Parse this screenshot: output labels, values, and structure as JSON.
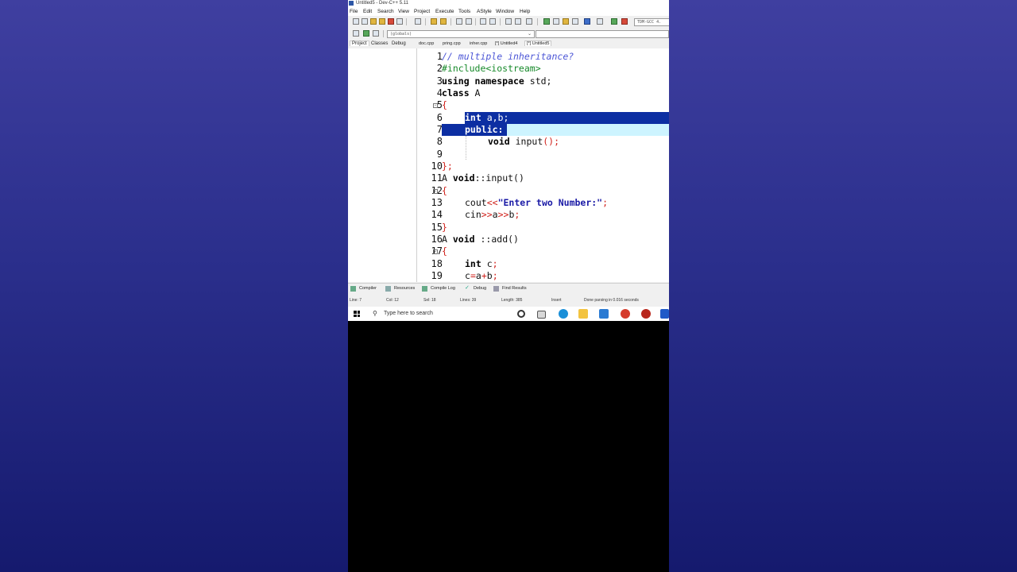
{
  "window": {
    "title": "Untitled5 - Dev-C++ 5.11"
  },
  "menu": [
    "File",
    "Edit",
    "Search",
    "View",
    "Project",
    "Execute",
    "Tools",
    "AStyle",
    "Window",
    "Help"
  ],
  "toolbar": {
    "compiler_select": "TDM-GCC 4.",
    "scope_select": "(globals)"
  },
  "left_panel": {
    "tabs": [
      "Project",
      "Classes",
      "Debug"
    ]
  },
  "file_tabs": [
    "doc.cpp",
    "pring.cpp",
    "inher.cpp",
    "[*] Untitled4",
    "[*] Untitled5"
  ],
  "editor": {
    "line_numbers": [
      "1",
      "2",
      "3",
      "4",
      "5",
      "6",
      "7",
      "8",
      "9",
      "10",
      "11",
      "12",
      "13",
      "14",
      "15",
      "16",
      "17",
      "18",
      "19"
    ],
    "lines": {
      "l1": "// multiple inheritance?",
      "l2": "#include<iostream>",
      "l3a": "using namespace",
      "l3b": " std;",
      "l4a": "class",
      "l4b": " A",
      "l5": "{",
      "l6a": "int",
      "l6b": " a,b;",
      "l7": "public:",
      "l8a": "void",
      "l8b": " input",
      "l8c": "();",
      "l10": "};",
      "l11a": "A ",
      "l11b": "void",
      "l11c": "::",
      "l11d": "input",
      "l11e": "()",
      "l12": "{",
      "l13a": "cout",
      "l13b": "<<",
      "l13c": "\"Enter two Number:\"",
      "l13d": ";",
      "l14a": "cin",
      "l14b": ">>",
      "l14c": "a",
      "l14d": ">>",
      "l14e": "b",
      "l14f": ";",
      "l15": "}",
      "l16a": "A ",
      "l16b": "void",
      "l16c": " ::",
      "l16d": "add",
      "l16e": "()",
      "l17": "{",
      "l18a": "int",
      "l18b": " c",
      "l18c": ";",
      "l19a": "c",
      "l19b": "=",
      "l19c": "a",
      "l19d": "+",
      "l19e": "b",
      "l19f": ";"
    }
  },
  "bottom_tabs": [
    "Compiler",
    "Resources",
    "Compile Log",
    "Debug",
    "Find Results"
  ],
  "status": {
    "line": "Line:   7",
    "col": "Col:   12",
    "sel": "Sel:   18",
    "lines": "Lines:   39",
    "length": "Length:   385",
    "mode": "Insert",
    "message": "Done parsing in 0.016 seconds"
  },
  "taskbar": {
    "search_placeholder": "Type here to search"
  },
  "colors": {
    "selection": "#0c2ea2",
    "selection_light": "#cdf4ff",
    "string": "#1a1aa6",
    "operator": "#d0201a",
    "comment": "#4b55d6",
    "preprocessor": "#178a2a"
  }
}
